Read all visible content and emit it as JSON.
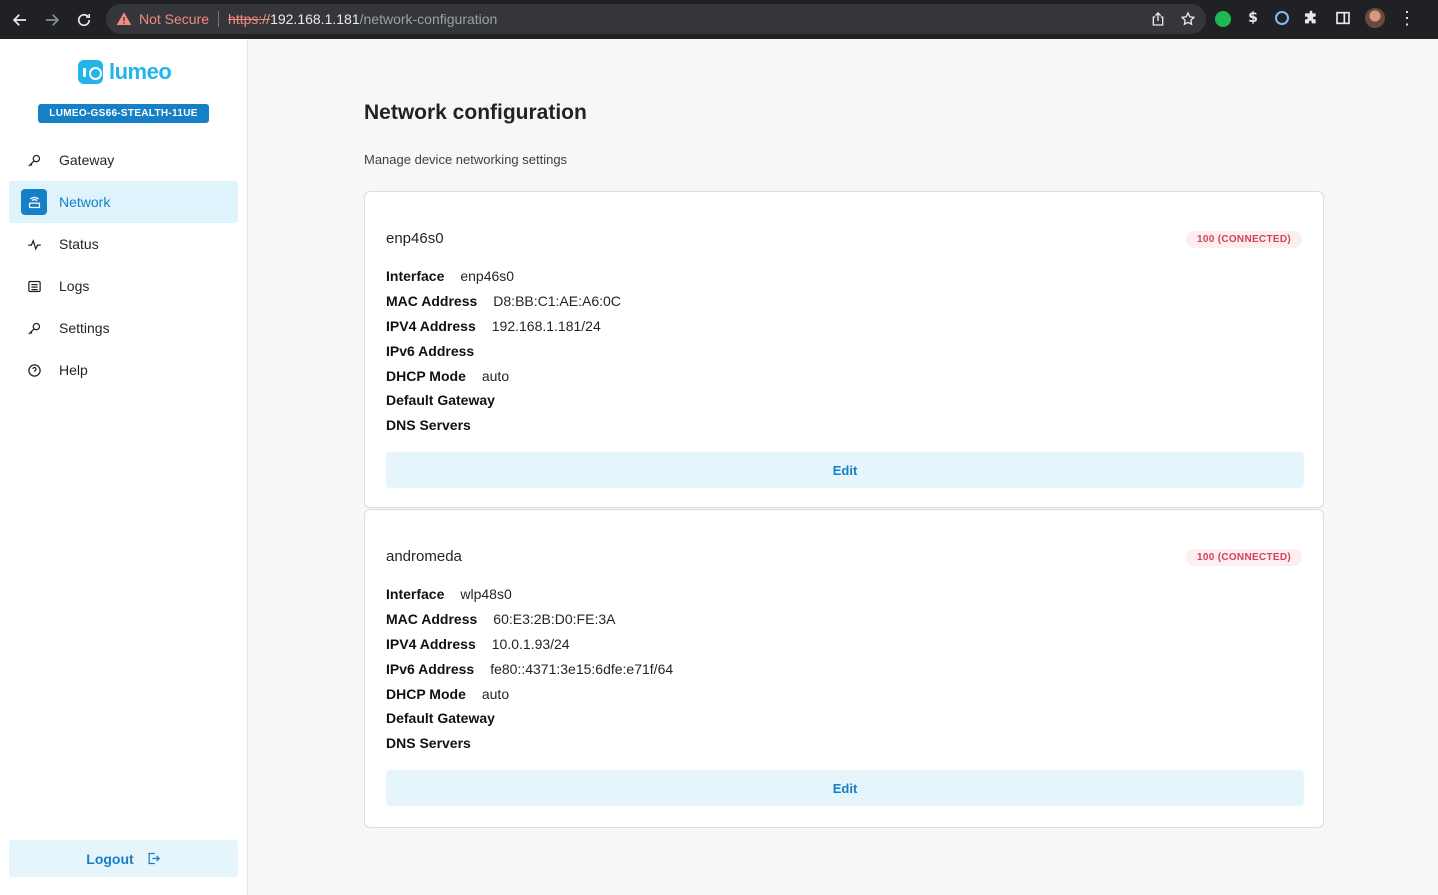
{
  "browser": {
    "security_label": "Not Secure",
    "url_scheme": "https://",
    "url_host": "192.168.1.181",
    "url_path": "/network-configuration"
  },
  "sidebar": {
    "logo_text": "lumeo",
    "device_name": "LUMEO-GS66-STEALTH-11UE",
    "items": [
      {
        "label": "Gateway",
        "icon": "wrench-icon",
        "active": false
      },
      {
        "label": "Network",
        "icon": "router-icon",
        "active": true
      },
      {
        "label": "Status",
        "icon": "pulse-icon",
        "active": false
      },
      {
        "label": "Logs",
        "icon": "list-icon",
        "active": false
      },
      {
        "label": "Settings",
        "icon": "wrench-icon",
        "active": false
      },
      {
        "label": "Help",
        "icon": "help-circle-icon",
        "active": false
      }
    ],
    "logout_label": "Logout"
  },
  "main": {
    "title": "Network configuration",
    "subtitle": "Manage device networking settings",
    "connections": [
      {
        "name": "enp46s0",
        "status": "100 (CONNECTED)",
        "fields": [
          {
            "key": "Interface",
            "value": "enp46s0"
          },
          {
            "key": "MAC Address",
            "value": "D8:BB:C1:AE:A6:0C"
          },
          {
            "key": "IPV4 Address",
            "value": "192.168.1.181/24"
          },
          {
            "key": "IPv6 Address",
            "value": ""
          },
          {
            "key": "DHCP Mode",
            "value": "auto"
          },
          {
            "key": "Default Gateway",
            "value": ""
          },
          {
            "key": "DNS Servers",
            "value": ""
          }
        ],
        "edit_label": "Edit"
      },
      {
        "name": "andromeda",
        "status": "100 (CONNECTED)",
        "fields": [
          {
            "key": "Interface",
            "value": "wlp48s0"
          },
          {
            "key": "MAC Address",
            "value": "60:E3:2B:D0:FE:3A"
          },
          {
            "key": "IPV4 Address",
            "value": "10.0.1.93/24"
          },
          {
            "key": "IPv6 Address",
            "value": "fe80::4371:3e15:6dfe:e71f/64"
          },
          {
            "key": "DHCP Mode",
            "value": "auto"
          },
          {
            "key": "Default Gateway",
            "value": ""
          },
          {
            "key": "DNS Servers",
            "value": ""
          }
        ],
        "edit_label": "Edit"
      }
    ]
  },
  "colors": {
    "accent": "#1580c6",
    "brand": "#21b5ea",
    "status_connected": "#d1425d"
  }
}
